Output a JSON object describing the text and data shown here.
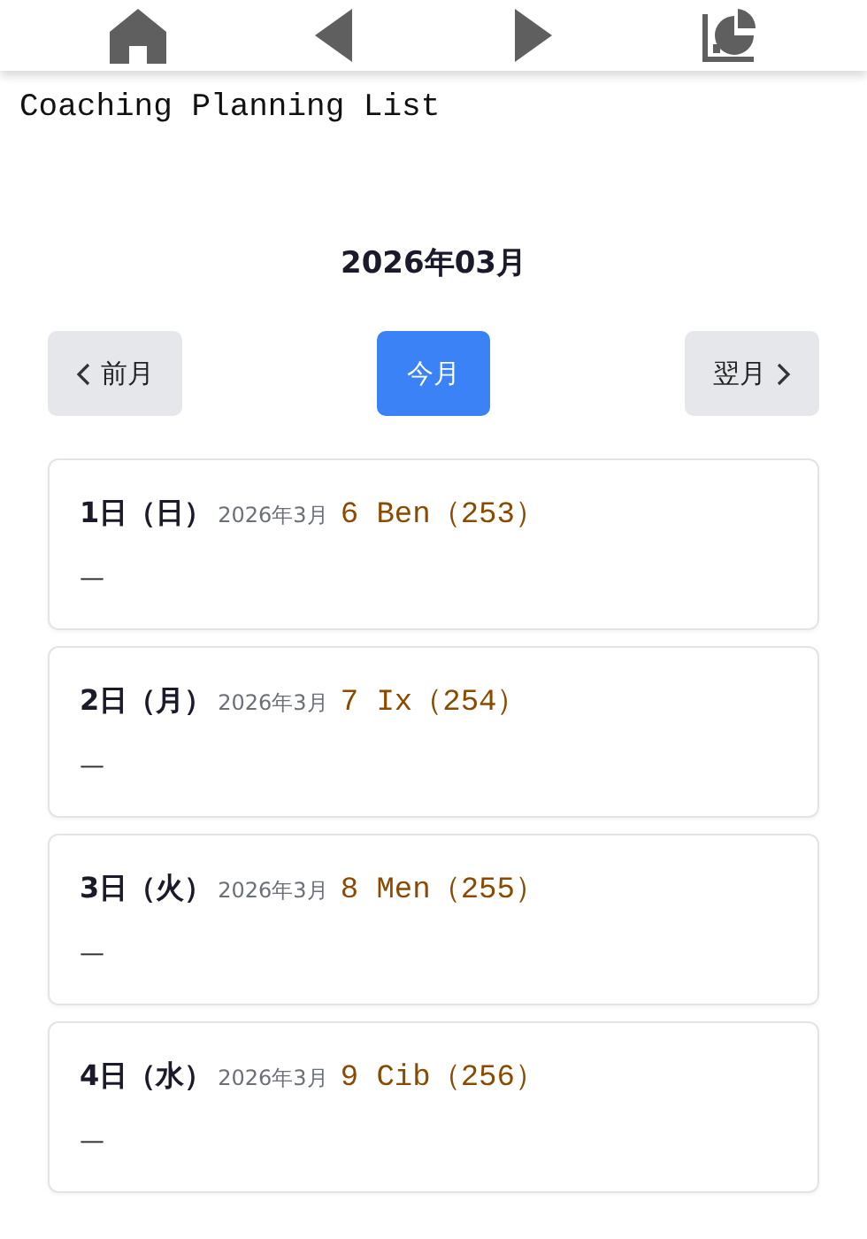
{
  "nav": [
    {
      "kind": "home"
    },
    {
      "kind": "back"
    },
    {
      "kind": "forward"
    },
    {
      "kind": "chart"
    }
  ],
  "title": "Coaching Planning List",
  "month": "2026年03月",
  "buttons": [
    {
      "kind": "prev",
      "label": "前月",
      "selected": false
    },
    {
      "kind": "current",
      "label": "今月",
      "selected": true
    },
    {
      "kind": "next",
      "label": "翌月",
      "selected": false
    }
  ],
  "days": [
    {
      "day": "1日（日）",
      "month": "2026年3月",
      "sign": "6 Ben（253）",
      "note": "—"
    },
    {
      "day": "2日（月）",
      "month": "2026年3月",
      "sign": "7 Ix（254）",
      "note": "—"
    },
    {
      "day": "3日（火）",
      "month": "2026年3月",
      "sign": "8 Men（255）",
      "note": "—"
    },
    {
      "day": "4日（水）",
      "month": "2026年3月",
      "sign": "9 Cib（256）",
      "note": "—"
    }
  ]
}
